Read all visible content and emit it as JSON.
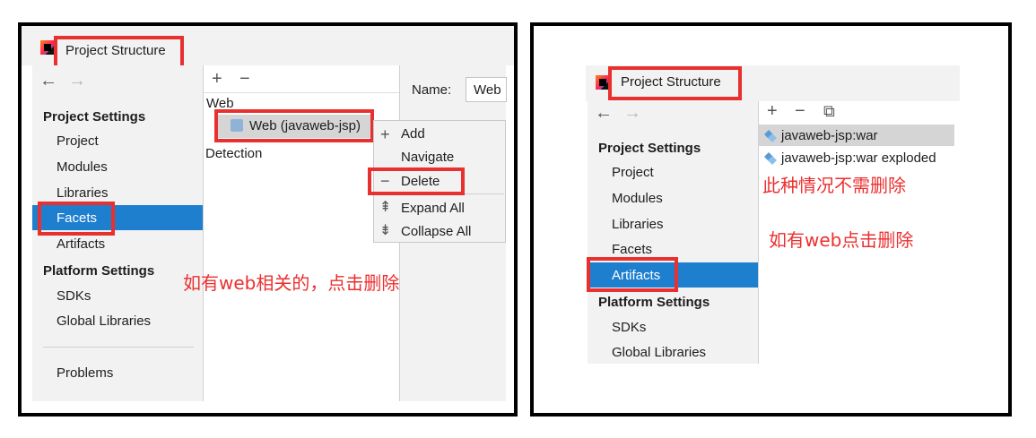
{
  "left": {
    "window_title": "Project Structure",
    "nav": {
      "back": "←",
      "forward": "→"
    },
    "sidebar": {
      "project_settings_header": "Project Settings",
      "items": [
        "Project",
        "Modules",
        "Libraries",
        "Facets",
        "Artifacts"
      ],
      "selected": "Facets",
      "platform_settings_header": "Platform Settings",
      "platform_items": [
        "SDKs",
        "Global Libraries"
      ],
      "problems": "Problems"
    },
    "middle": {
      "add": "+",
      "remove": "−",
      "group_label": "Web",
      "facet_item": "Web (javaweb-jsp)",
      "detection": "Detection"
    },
    "name_label": "Name:",
    "name_value": "Web",
    "context_menu": [
      {
        "icon": "+",
        "label": "Add"
      },
      {
        "icon": "",
        "label": "Navigate"
      },
      {
        "icon": "−",
        "label": "Delete"
      },
      {
        "icon": "⇞",
        "label": "Expand All"
      },
      {
        "icon": "⇟",
        "label": "Collapse All"
      }
    ],
    "annotation": "如有web相关的，点击删除"
  },
  "right": {
    "window_title": "Project Structure",
    "nav": {
      "back": "←",
      "forward": "→"
    },
    "toolbar": {
      "add": "+",
      "remove": "−",
      "copy": "⧉"
    },
    "sidebar": {
      "project_settings_header": "Project Settings",
      "items": [
        "Project",
        "Modules",
        "Libraries",
        "Facets",
        "Artifacts"
      ],
      "selected": "Artifacts",
      "platform_settings_header": "Platform Settings",
      "platform_items": [
        "SDKs",
        "Global Libraries"
      ]
    },
    "artifacts": [
      "javaweb-jsp:war",
      "javaweb-jsp:war exploded"
    ],
    "annotation_1": "此种情况不需删除",
    "annotation_2": "如有web点击删除"
  },
  "colors": {
    "selection": "#1f7fcf",
    "annotation": "#ec2f2f",
    "sidebar_bg": "#f2f2f2"
  }
}
